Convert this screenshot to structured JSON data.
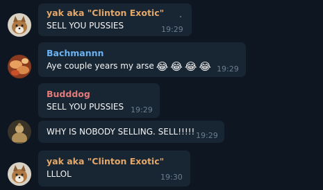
{
  "colors": {
    "background": "#0e1621",
    "bubble": "#182533",
    "sender_orange": "#e4a86a",
    "sender_blue": "#6ab3f3",
    "sender_red": "#e37a7a",
    "time": "#6d7f8f"
  },
  "messages": [
    {
      "sender": "yak aka \"Clinton Exotic\"",
      "text": "SELL YOU PUSSIES",
      "time": "19:29",
      "avatar": "fox-avatar-icon"
    },
    {
      "sender": "Bachmannn",
      "text": "Aye couple years my arse",
      "emojis": [
        "😂",
        "😂",
        "😂",
        "😂"
      ],
      "time": "19:29",
      "avatar": "food-avatar-icon"
    },
    {
      "sender": "Budddog",
      "text": "SELL YOU PUSSIES",
      "time": "19:29"
    },
    {
      "text": "WHY IS NOBODY SELLING. SELL!!!!!",
      "time": "19:29",
      "avatar": "buddha-avatar-icon"
    },
    {
      "sender": "yak aka \"Clinton Exotic\"",
      "text": "LLLOL",
      "time": "19:30",
      "avatar": "fox-avatar-icon"
    }
  ]
}
